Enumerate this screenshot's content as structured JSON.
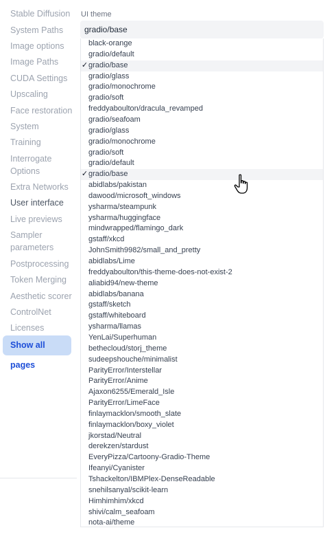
{
  "sidebar": {
    "items": [
      {
        "label": "Stable Diffusion"
      },
      {
        "label": "System Paths"
      },
      {
        "label": "Image options"
      },
      {
        "label": "Image Paths"
      },
      {
        "label": "CUDA Settings"
      },
      {
        "label": "Upscaling"
      },
      {
        "label": "Face restoration"
      },
      {
        "label": "System"
      },
      {
        "label": "Training"
      },
      {
        "label": "Interrogate Options"
      },
      {
        "label": "Extra Networks"
      },
      {
        "label": "User interface"
      },
      {
        "label": "Live previews"
      },
      {
        "label": "Sampler parameters"
      },
      {
        "label": "Postprocessing"
      },
      {
        "label": "Token Merging"
      },
      {
        "label": "Aesthetic scorer"
      },
      {
        "label": "ControlNet"
      },
      {
        "label": "Licenses"
      }
    ],
    "active": "User interface",
    "show_all_label": "Show all pages"
  },
  "settings": {
    "ui_theme_label": "UI theme",
    "ui_theme_value": "gradio/base",
    "check_mark": "✓",
    "options": [
      "black-orange",
      "gradio/default",
      "gradio/base",
      "gradio/glass",
      "gradio/monochrome",
      "gradio/soft",
      "freddyaboulton/dracula_revamped",
      "gradio/seafoam",
      "gradio/glass",
      "gradio/monochrome",
      "gradio/soft",
      "gradio/default",
      "gradio/base",
      "abidlabs/pakistan",
      "dawood/microsoft_windows",
      "ysharma/steampunk",
      "ysharma/huggingface",
      "mindwrapped/flamingo_dark",
      "gstaff/xkcd",
      "JohnSmith9982/small_and_pretty",
      "abidlabs/Lime",
      "freddyaboulton/this-theme-does-not-exist-2",
      "aliabid94/new-theme",
      "abidlabs/banana",
      "gstaff/sketch",
      "gstaff/whiteboard",
      "ysharma/llamas",
      "YenLai/Superhuman",
      "bethecloud/storj_theme",
      "sudeepshouche/minimalist",
      "ParityError/Interstellar",
      "ParityError/Anime",
      "Ajaxon6255/Emerald_Isle",
      "ParityError/LimeFace",
      "finlaymacklon/smooth_slate",
      "finlaymacklon/boxy_violet",
      "jkorstad/Neutral",
      "derekzen/stardust",
      "EveryPizza/Cartoony-Gradio-Theme",
      "Ifeanyi/Cyanister",
      "Tshackelton/IBMPlex-DenseReadable",
      "snehilsanyal/scikit-learn",
      "Himhimhim/xkcd",
      "shivi/calm_seafoam",
      "nota-ai/theme"
    ]
  },
  "cursor_icon": "hand-pointer-icon"
}
